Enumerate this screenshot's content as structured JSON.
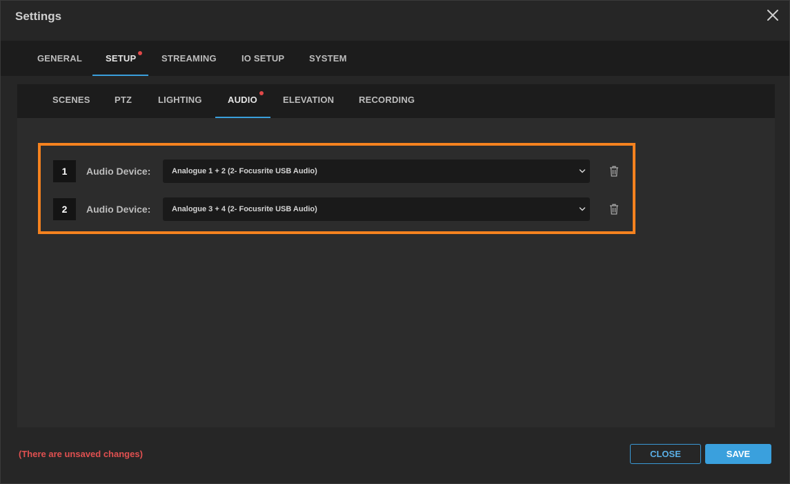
{
  "dialog": {
    "title": "Settings",
    "close_icon": "close-icon"
  },
  "main_tabs": [
    {
      "label": "GENERAL",
      "active": false,
      "has_dot": false
    },
    {
      "label": "SETUP",
      "active": true,
      "has_dot": true
    },
    {
      "label": "STREAMING",
      "active": false,
      "has_dot": false
    },
    {
      "label": "IO SETUP",
      "active": false,
      "has_dot": false
    },
    {
      "label": "SYSTEM",
      "active": false,
      "has_dot": false
    }
  ],
  "sub_tabs": [
    {
      "label": "SCENES",
      "active": false,
      "has_dot": false
    },
    {
      "label": "PTZ",
      "active": false,
      "has_dot": false
    },
    {
      "label": "LIGHTING",
      "active": false,
      "has_dot": false
    },
    {
      "label": "AUDIO",
      "active": true,
      "has_dot": true
    },
    {
      "label": "ELEVATION",
      "active": false,
      "has_dot": false
    },
    {
      "label": "RECORDING",
      "active": false,
      "has_dot": false
    }
  ],
  "audio_devices": [
    {
      "number": "1",
      "label": "Audio Device:",
      "selected": "Analogue 1 + 2 (2- Focusrite USB Audio)",
      "delete_icon": "trash-icon"
    },
    {
      "number": "2",
      "label": "Audio Device:",
      "selected": "Analogue 3 + 4 (2- Focusrite USB Audio)",
      "delete_icon": "trash-icon"
    }
  ],
  "footer": {
    "unsaved_text": "(There are unsaved changes)",
    "close_label": "CLOSE",
    "save_label": "SAVE"
  },
  "colors": {
    "accent": "#3aa0dd",
    "highlight": "#f5821f",
    "warning": "#e05050",
    "notification_dot": "#e04848"
  }
}
